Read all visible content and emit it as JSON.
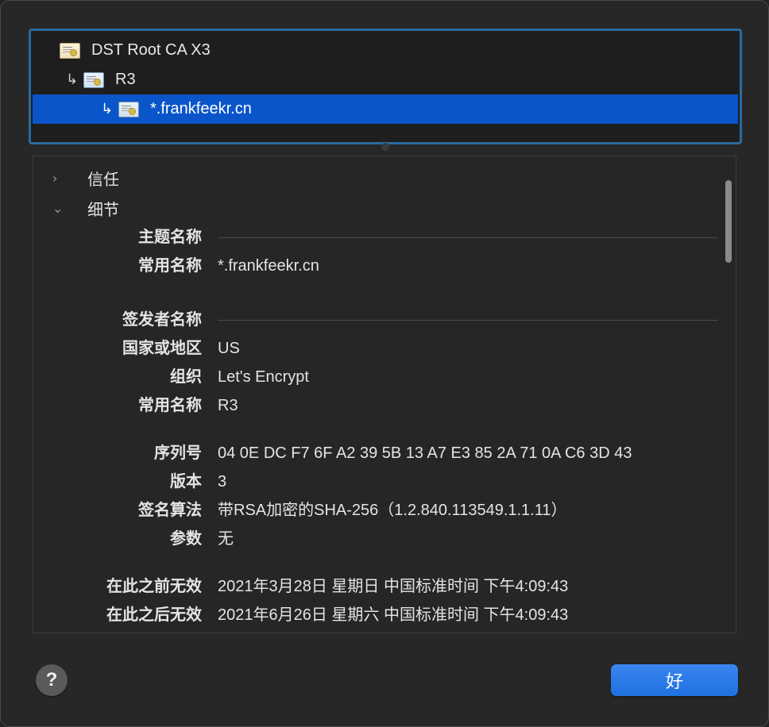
{
  "chain": {
    "items": [
      {
        "label": "DST Root CA X3",
        "icon": "certificate-icon"
      },
      {
        "arrow": "↳",
        "label": "R3",
        "icon": "certificate-icon"
      },
      {
        "arrow": "↳",
        "label": "*.frankfeekr.cn",
        "icon": "certificate-icon"
      }
    ]
  },
  "details": {
    "trust_label": "信任",
    "details_label": "细节",
    "disclosure_collapsed": "›",
    "disclosure_expanded": "⌄",
    "subject_name_label": "主题名称",
    "subject_common_name_label": "常用名称",
    "subject_common_name": "*.frankfeekr.cn",
    "issuer_name_label": "签发者名称",
    "issuer_country_label": "国家或地区",
    "issuer_country": "US",
    "issuer_org_label": "组织",
    "issuer_org": "Let's Encrypt",
    "issuer_common_name_label": "常用名称",
    "issuer_common_name": "R3",
    "serial_label": "序列号",
    "serial": "04 0E DC F7 6F A2 39 5B 13 A7 E3 85 2A 71 0A C6 3D 43",
    "version_label": "版本",
    "version": "3",
    "sig_alg_label": "签名算法",
    "sig_alg": "带RSA加密的SHA-256（1.2.840.113549.1.1.11）",
    "params_label": "参数",
    "params": "无",
    "not_before_label": "在此之前无效",
    "not_before": "2021年3月28日 星期日 中国标准时间 下午4:09:43",
    "not_after_label": "在此之后无效",
    "not_after": "2021年6月26日 星期六 中国标准时间 下午4:09:43"
  },
  "footer": {
    "help_label": "?",
    "ok_label": "好"
  },
  "colors": {
    "selection": "#0a55c9",
    "accent_border": "#2b6a9e",
    "ok_button": "#2a78e8"
  }
}
